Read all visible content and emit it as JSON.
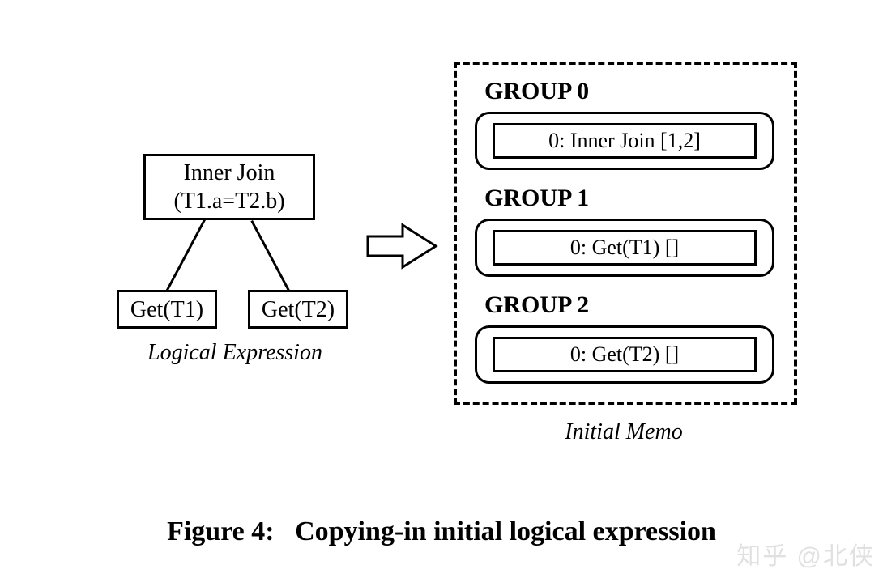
{
  "tree": {
    "root": {
      "line1": "Inner Join",
      "line2": "(T1.a=T2.b)"
    },
    "left": "Get(T1)",
    "right": "Get(T2)"
  },
  "labels": {
    "logical_expression": "Logical Expression",
    "initial_memo": "Initial Memo"
  },
  "memo": {
    "groups": [
      {
        "title": "GROUP 0",
        "expr": "0: Inner Join [1,2]"
      },
      {
        "title": "GROUP 1",
        "expr": "0: Get(T1) []"
      },
      {
        "title": "GROUP 2",
        "expr": "0: Get(T2) []"
      }
    ]
  },
  "caption": {
    "prefix": "Figure 4:",
    "text": "Copying-in initial logical expression"
  },
  "watermark": "知乎 @北侠"
}
